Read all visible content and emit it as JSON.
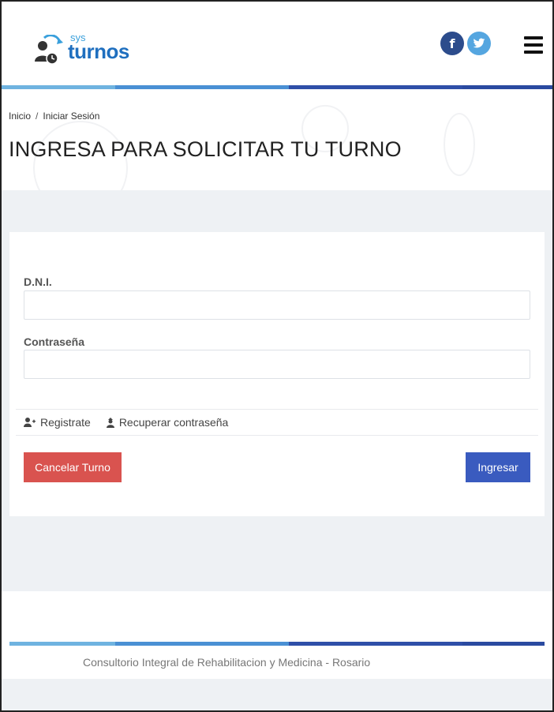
{
  "header": {
    "logo": {
      "small_text": "sys",
      "big_text": "turnos"
    },
    "social": [
      {
        "name": "facebook",
        "glyph": "f",
        "color": "#2c4c8c"
      },
      {
        "name": "twitter",
        "glyph": "t",
        "color": "#55a6e0"
      }
    ],
    "menu_icon": "hamburger-icon"
  },
  "stripe_colors": [
    "#6fb3e0",
    "#4a90d4",
    "#2f4fa8",
    "#2a4aa0"
  ],
  "breadcrumb": {
    "home": "Inicio",
    "separator": "/",
    "current": "Iniciar Sesión"
  },
  "page_title": "INGRESA PARA SOLICITAR TU TURNO",
  "form": {
    "dni_label": "D.N.I.",
    "dni_value": "",
    "password_label": "Contraseña",
    "password_value": "",
    "register_link": "Registrate",
    "recover_link": "Recuperar contraseña",
    "cancel_button": "Cancelar Turno",
    "login_button": "Ingresar"
  },
  "colors": {
    "cancel": "#d9534f",
    "login": "#3a5bbf",
    "content_bg": "#eef1f4"
  },
  "footer": {
    "text": "Consultorio Integral de Rehabilitacion y Medicina - Rosario"
  }
}
